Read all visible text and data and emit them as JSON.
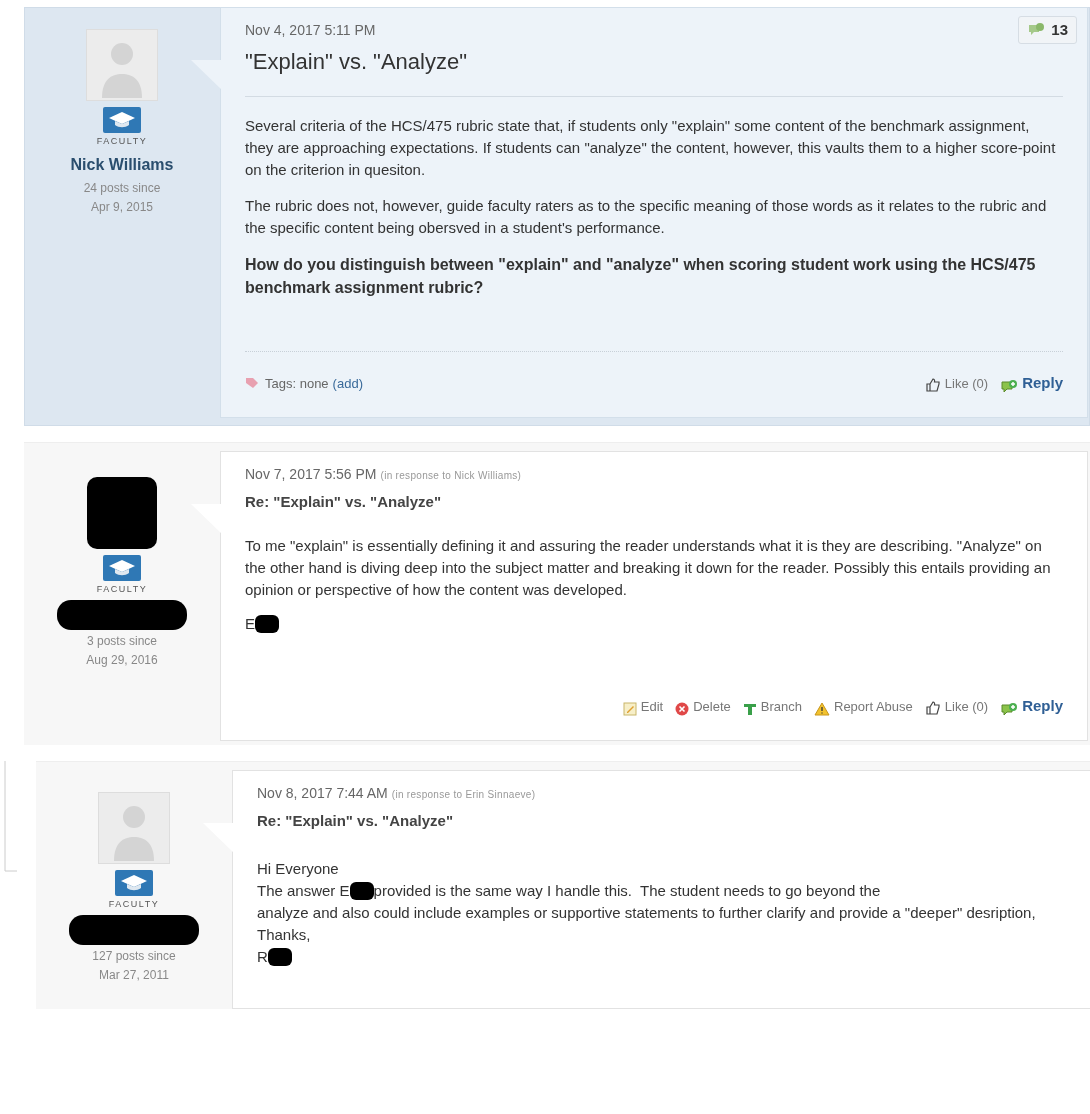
{
  "posts": [
    {
      "kind": "original",
      "selected": true,
      "author": {
        "name": "Nick Williams",
        "name_redacted": false,
        "avatar_redacted": false,
        "role": "FACULTY",
        "posts_count": "24 posts since",
        "since": "Apr 9, 2015"
      },
      "date": "Nov 4, 2017 5:11 PM",
      "title": "\"Explain\" vs. \"Analyze\"",
      "reply_count": "13",
      "body": [
        [
          {
            "kind": "text",
            "text": "Several criteria of the HCS/475 rubric state that, if students only \"explain\" some content of the benchmark assignment, they are approaching expectations. If students can \"analyze\" the content, however, this vaults them to a higher score-point on the criterion in quesiton."
          }
        ],
        [
          {
            "kind": "text",
            "text": "The rubric does not, however, guide faculty raters as to the specific meaning of those words as it relates to the rubric and the specific content being obersved in a student's performance."
          }
        ],
        [
          {
            "kind": "bold",
            "text": "How do you distinguish between \"explain\" and \"analyze\" when scoring student work using the HCS/475 benchmark assignment rubric?"
          }
        ]
      ],
      "tags": {
        "label": "Tags: none",
        "add": "(add)"
      },
      "actions": [
        {
          "kind": "like",
          "label": "Like (0)"
        },
        {
          "kind": "reply",
          "label": "Reply"
        }
      ]
    },
    {
      "kind": "reply",
      "selected": false,
      "author": {
        "name_redacted": true,
        "avatar_redacted": true,
        "role": "FACULTY",
        "posts_count": "3 posts since",
        "since": "Aug 29, 2016"
      },
      "date": "Nov 7, 2017 5:56 PM",
      "in_response": "(in response to Nick Williams)",
      "title": "Re: \"Explain\" vs. \"Analyze\"",
      "body": [
        [
          {
            "kind": "text",
            "text": "To me \"explain\" is essentially defining it and assuring the reader understands what it is they are describing. \"Analyze\" on the other hand is diving deep into the subject matter and breaking it down for the reader. Possibly this entails providing an opinion or perspective of how the content was developed."
          }
        ],
        [
          {
            "kind": "text",
            "text": "E"
          },
          {
            "kind": "redaction"
          }
        ]
      ],
      "actions": [
        {
          "kind": "edit",
          "label": "Edit"
        },
        {
          "kind": "delete",
          "label": "Delete"
        },
        {
          "kind": "branch",
          "label": "Branch"
        },
        {
          "kind": "report",
          "label": "Report Abuse"
        },
        {
          "kind": "like",
          "label": "Like (0)"
        },
        {
          "kind": "reply",
          "label": "Reply"
        }
      ]
    },
    {
      "kind": "nested",
      "selected": false,
      "author": {
        "name_redacted": true,
        "avatar_redacted": false,
        "role": "FACULTY",
        "posts_count": "127 posts since",
        "since": "Mar 27, 2011"
      },
      "date": "Nov 8, 2017 7:44 AM",
      "in_response": "(in response to Erin Sinnaeve)",
      "title": "Re: \"Explain\" vs. \"Analyze\"",
      "body": [
        [
          {
            "kind": "text",
            "text": "Hi Everyone"
          }
        ],
        [
          {
            "kind": "text",
            "text": "The answer E"
          },
          {
            "kind": "redaction"
          },
          {
            "kind": "text",
            "text": "provided is the same way I handle this.  The student needs to go beyond the"
          }
        ],
        [
          {
            "kind": "text",
            "text": "analyze and also could include examples or supportive statements to further clarify and provide a \"deeper\" desription,"
          }
        ],
        [
          {
            "kind": "text",
            "text": "Thanks,"
          }
        ],
        [
          {
            "kind": "text",
            "text": "R"
          },
          {
            "kind": "redaction"
          }
        ]
      ]
    }
  ]
}
